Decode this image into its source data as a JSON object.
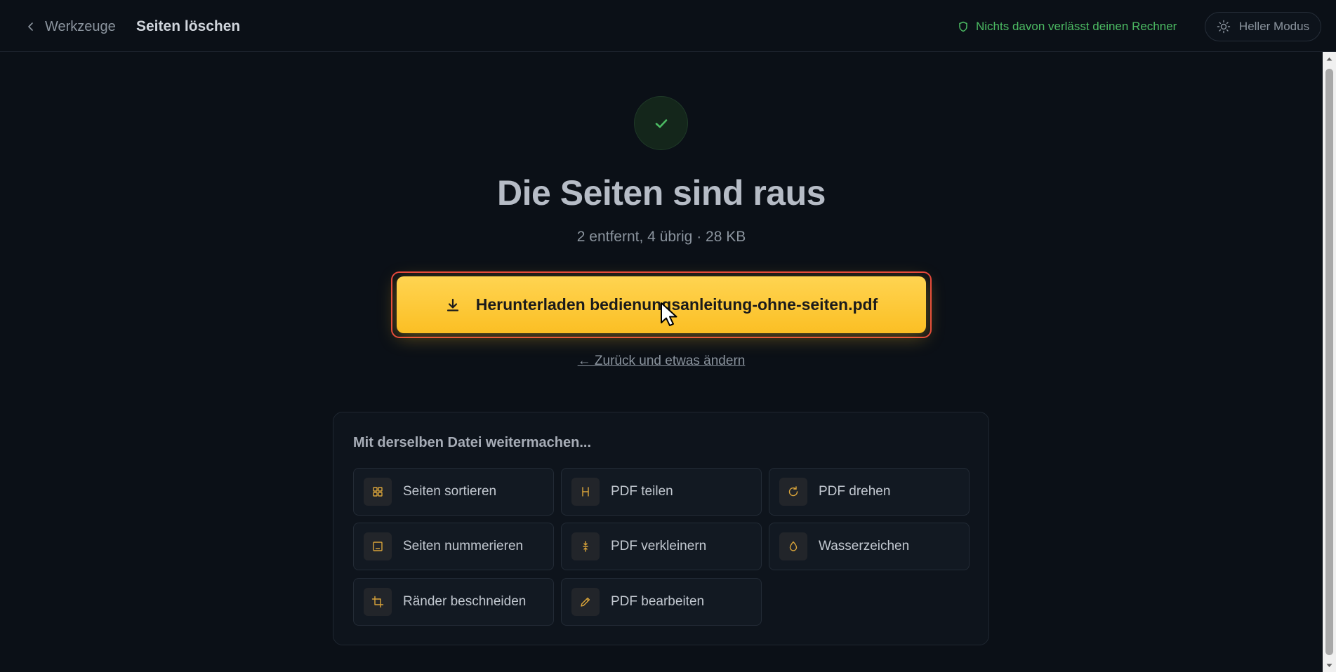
{
  "header": {
    "back_label": "Werkzeuge",
    "page_title": "Seiten löschen",
    "privacy_note": "Nichts davon verlässt deinen Rechner",
    "theme_toggle_label": "Heller Modus"
  },
  "result": {
    "headline": "Die Seiten sind raus",
    "summary": "2 entfernt, 4 übrig · 28 KB",
    "download_label": "Herunterladen bedienungsanleitung-ohne-seiten.pdf",
    "back_change_label": "← Zurück und etwas ändern"
  },
  "next_steps": {
    "title": "Mit derselben Datei weitermachen...",
    "tools": [
      {
        "label": "Seiten sortieren",
        "icon": "grid-icon"
      },
      {
        "label": "PDF teilen",
        "icon": "split-icon"
      },
      {
        "label": "PDF drehen",
        "icon": "rotate-icon"
      },
      {
        "label": "Seiten nummerieren",
        "icon": "page-number-icon"
      },
      {
        "label": "PDF verkleinern",
        "icon": "compress-icon"
      },
      {
        "label": "Wasserzeichen",
        "icon": "droplet-icon"
      },
      {
        "label": "Ränder beschneiden",
        "icon": "crop-icon"
      },
      {
        "label": "PDF bearbeiten",
        "icon": "pencil-icon"
      }
    ]
  },
  "colors": {
    "background": "#0b1017",
    "accent": "#fbbf24",
    "success": "#4cbb63",
    "highlight_outline": "#e5453d",
    "icon_accent": "#d9a43a"
  }
}
